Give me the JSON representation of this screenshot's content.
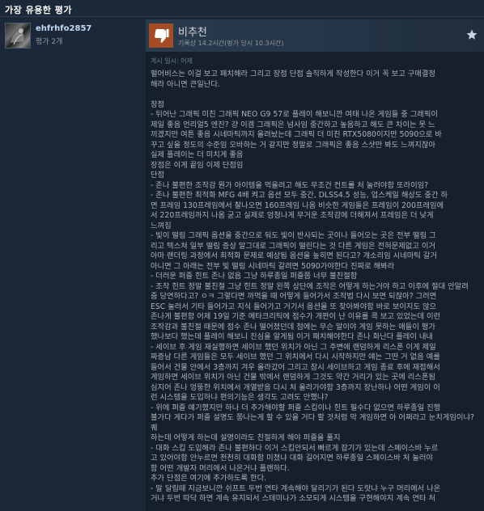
{
  "section": {
    "title": "가장 유용한 평가"
  },
  "author": {
    "name": "ehfrhfo2857",
    "review_count": "평가 2개"
  },
  "review": {
    "verdict": "비추천",
    "hours": "기록상 14.2시간(평가 당시 10.3시간)",
    "posted": "게시 일시: 어제",
    "icons": {
      "verdict": "thumbs-down-icon",
      "award": "award-icon"
    },
    "colors": {
      "thumb_bg": "#a34c25",
      "header_bg": "#2a3b4e",
      "body_bg": "#16202d"
    },
    "paragraphs": [
      "펄어비스는 이걸 보고 패치해라 그리고 장점 단점 솔직하게 작성한다 이거 꼭 보고 구매결정",
      "해라 아니면 큰일난다.",
      "",
      "장점",
      "- 뒤어난 그래픽 미친 그래픽 NEO G9 57로 플레이 해보니깐 여태 나온 게임들 중 그래픽이",
      "제일 좋음 언리얼5 엔진? 걍 이겜 그래픽은 넘사임 중간하고 높음하고 해도 큰 차이는 못 느",
      "끼겠지만 여튼 좋음 시네마틱까지 올려놨는데 그래픽 더 미친 RTX5080이지만 5090으로 바",
      "꾸고 싶을 정도의 수준임 오바하는 거 같지만 정말로 그래픽은 좋음 스샷만 봐도 느껴지잖아",
      "실제 플레이는 더 미치게 좋음",
      "장점은 이게 끝임 이제 단점임",
      "단점",
      "- 존나 불편한 조작감 뭔가 아이템을 먹을려고 해도 무조건 컨트롤 처 눌러야함 또라이임?",
      "- 존나 불편한 최적화 MFG 4배 켜고 옵션 모두 중간, DLSS4.5 성능, 업스케일 해상도 중간 하",
      "면 프레임 130프레임에서 찰나오면 160프레임 나옴 비슷한 게임들은 프레임이 200프레임에",
      "서 220프레임까지 나옴 굳고 실제로 엄청나게 무거운 조작감에 더해져서 프레임은 더 낮게",
      "느껴짐",
      "- 빛이 떨림 그래픽 옵션을 중간으로 둬도 빛이 반사되는 곳이나 들어오는 곳은 전부 떨림 그",
      "리고 텍스쳐 일부 떨림 증상 말그대로 그래픽이 떨린다는 것 다른 게임은 전혀문제없고 이거",
      "아마 랜더링 과정에서 최적화 문제로 예상됨 옵션을 높히면 된다고? 개소리임 시네마틱 갈거",
      "아니면 그 아래는 전부 빛 떨림 시네마틱 갈려면 5090가야한다 진짜로 해봐라",
      "- 더러운 퍼즐 힌트 존나 없음 그냥 하루종일 퍼즐쯤 너무 불친절함",
      "- 조작 힌트 정말 불친절 그냥 힌트 정말 왼쪽 상단에 조작은 어떻게 하는거야 하고 이후에 절대 안알려",
      "줌 당연하다고? ㅇㅋ 그렇다면 까먹을 때 어떻게 들어가서 조작법 다시 보면 되잖아? 그러면",
      "ESC 눌러서 기타 들어가고 지식 들어가고 거기서 옵션을 또 찾아봐야함 바로 보이지도 않으",
      "존나게 불편함 어제 19일 기준 메타크리틱에 점수가 개판이 난 이유를 콕 보고 있었는데 이런",
      "조작감과 불친절 때문에 점수 존나 떨어졌던데 첨에는 무슨 말이야 게임 못하는 애들이 평가",
      "했나보다 했는데 플레이 해보니 진심을 알게됨 이거 패치해야한다 존나 화난다 플레이 내내",
      "- 세이브 후 게임 재실행하면 세이브 했던 위치가 아닌 그 주변에 랜덤하게 리스폰 이게 제일",
      "짜증남 다른 게임들은 모두 세이브 했던 그 위치에서 다시 시작하지만 얘는 그딴 거 없음 예를",
      "들어서 건물 안에서 3층까지 겨우 올라갔어 그리고 잠시 세이브하고 게임 종료 후에 재접해서",
      "게임하면 세이브 위치가 아닌 건물 밖에서 랜덤하게 그것도 약간 거리가 있는 곳에 리스폰됨",
      "심지어 존나 엉뚱한 위치에서 개열받음 다시 처 올라가야함 3층까지 장난하나 어떤 게임이 이",
      "런 시스템을 도입하냐 편의기능은 생각도 고려도 안했냐?",
      "- 위에 퍼즐 얘기했지만 하나 더 추가해야할 퍼즐 스킵이나 힌트 필수다 없으면 하루종일 진행",
      "불가다 게다가 퍼즐 설명도 쫑나는게 할 수 있을 거다 할 것처럼 막 게임하면 아 어쩌라고 눈치게임이냐? 퀘",
      "하는데 어떻게 하는데 설명이라도 친절하게 해야 퍼즐을 풀지",
      "- 대화 스킵 도입해라 존나 불편하다 이거 스킵안되서 빠르게 잡기가 있는데 스페이스바 누르",
      "고 있어야함 안누르면 천천히 대화함 미쳤냐 대화 길어지면 하루종일 스페이스바 처 눌러야",
      "함 어떤 개발자 머리에서 나온거냐 플랜하다.",
      "추가 단점은 여기에 추가하도록 한다.",
      "- 말 달림때 지금보니깐 쉬프트 두번 연타 계속해야 달리기가 된다 도랏냐 누구 머리에서 나온",
      "거냐 두번 따닥 하면 계속 유지되서 스테미나가 소모되게 시스템을 구현해야지 계속 연타 처"
    ]
  }
}
